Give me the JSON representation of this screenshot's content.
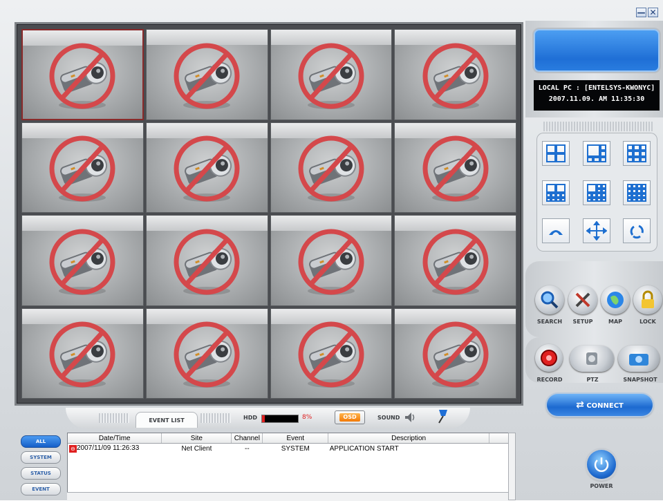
{
  "window": {
    "minimize_glyph": "—",
    "close_glyph": "✕"
  },
  "info": {
    "local_pc": "LOCAL PC : [ENTELSYS-KWONYC]",
    "datetime": "2007.11.09. AM 11:35:30"
  },
  "grid": {
    "rows": 4,
    "cols": 4,
    "selected_index": 0,
    "cell_icon": "no-camera-icon"
  },
  "action_buttons": [
    {
      "label": "SEARCH",
      "icon": "search-icon"
    },
    {
      "label": "SETUP",
      "icon": "setup-tools-icon"
    },
    {
      "label": "MAP",
      "icon": "map-globe-icon"
    },
    {
      "label": "LOCK",
      "icon": "lock-icon"
    }
  ],
  "control_buttons": [
    {
      "label": "RECORD",
      "icon": "record-icon"
    },
    {
      "label": "PTZ",
      "icon": "ptz-icon"
    },
    {
      "label": "SNAPSHOT",
      "icon": "snapshot-camera-icon"
    }
  ],
  "connect_label": "CONNECT",
  "power_label": "POWER",
  "bottom_bar": {
    "event_list_tab": "EVENT LIST",
    "hdd_label": "HDD",
    "hdd_percent_text": "8%",
    "hdd_fraction": 0.08,
    "osd_label": "OSD",
    "sound_label": "SOUND"
  },
  "filter_buttons": [
    "ALL",
    "SYSTEM",
    "STATUS",
    "EVENT"
  ],
  "event_table": {
    "columns": [
      "Date/Time",
      "Site",
      "Channel",
      "Event",
      "Description"
    ],
    "rows": [
      {
        "datetime": "2007/11/09 11:26:33",
        "site": "Net Client",
        "channel": "--",
        "event": "SYSTEM",
        "description": "APPLICATION START"
      }
    ]
  },
  "colors": {
    "accent_blue": "#1d6ad0",
    "record_red": "#e02020",
    "osd_orange": "#f37a06"
  }
}
